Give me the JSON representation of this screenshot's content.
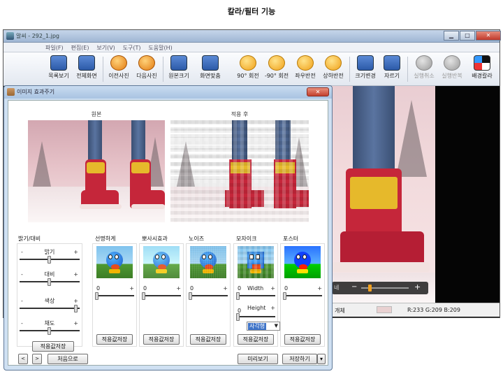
{
  "page_title": "칼라/필터 기능",
  "viewer": {
    "title": "알씨 - 292_1.jpg",
    "menu": [
      "파일(F)",
      "편집(E)",
      "보기(V)",
      "도구(T)",
      "도움말(H)"
    ],
    "toolbar": [
      {
        "label": "목록보기",
        "icon": "list-view-icon"
      },
      {
        "label": "전체화면",
        "icon": "fullscreen-icon"
      },
      {
        "label": "이전사진",
        "icon": "prev-photo-icon"
      },
      {
        "label": "다음사진",
        "icon": "next-photo-icon"
      },
      {
        "label": "원본크기",
        "icon": "original-size-icon"
      },
      {
        "label": "화면맞춤",
        "icon": "fit-screen-icon"
      },
      {
        "label": "90° 회전",
        "icon": "rotate-90-icon"
      },
      {
        "label": "-90° 회전",
        "icon": "rotate-minus-90-icon"
      },
      {
        "label": "좌우반전",
        "icon": "flip-horizontal-icon"
      },
      {
        "label": "상하반전",
        "icon": "flip-vertical-icon"
      },
      {
        "label": "크기변경",
        "icon": "resize-icon"
      },
      {
        "label": "자르기",
        "icon": "crop-icon"
      },
      {
        "label": "실행취소",
        "icon": "undo-icon"
      },
      {
        "label": "실행반복",
        "icon": "redo-icon"
      },
      {
        "label": "배경칼라",
        "icon": "background-color-icon"
      }
    ],
    "zoom_left": "네",
    "status_left": "개체",
    "status_rgb": "R:233 G:209 B:209"
  },
  "dialog": {
    "title": "이미지 효과주기",
    "original_label": "원본",
    "applied_label": "적용 후",
    "brightness_section": "밝기/대비",
    "sliders": [
      {
        "label": "밝기",
        "value": 0.5
      },
      {
        "label": "대비",
        "value": 0.5
      },
      {
        "label": "색상",
        "value": 0.98
      },
      {
        "label": "채도",
        "value": 0.5
      }
    ],
    "effects": [
      {
        "label": "선명하게",
        "value": "0"
      },
      {
        "label": "뽀사시효과",
        "value": "0"
      },
      {
        "label": "노이즈",
        "value": "0"
      },
      {
        "label": "모자이크",
        "value": "0"
      },
      {
        "label": "포스터",
        "value": "0"
      }
    ],
    "mosaic_width_label": "Width",
    "mosaic_height_label": "Height",
    "mosaic_height_value": "0",
    "mosaic_shape": "사각형",
    "minus": "-",
    "plus": "+",
    "save_label": "적용값저장",
    "nav_prev": "<",
    "nav_next": ">",
    "reset_label": "처음으로",
    "preview_label": "미리보기",
    "save_as_label": "저장하기",
    "save_arrow": "▾"
  }
}
